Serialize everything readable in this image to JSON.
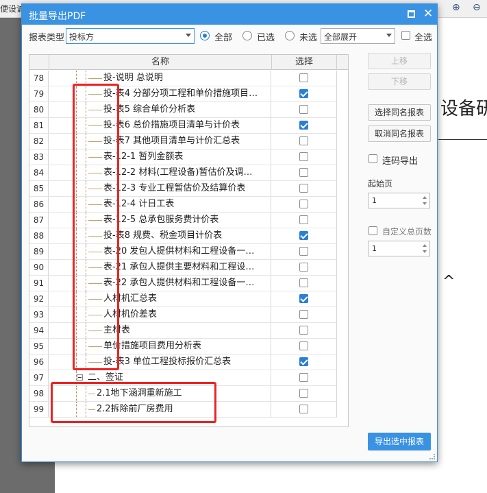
{
  "app": {
    "toolbar_left_fragment": "便设诚",
    "paper_heading_fragment": "设备研",
    "paper_mark_fragment": "^"
  },
  "dialog": {
    "title": "批量导出PDF",
    "filter": {
      "report_type_label": "报表类型",
      "report_type_value": "投标方",
      "radio_all": "全部",
      "radio_selected": "已选",
      "radio_unselected": "未选",
      "expand_value": "全部展开",
      "select_all": "全选"
    },
    "grid": {
      "header_name": "名称",
      "header_select": "选择",
      "rows": [
        {
          "num": "78",
          "name": "投-说明  总说明",
          "level": 2,
          "checked": false
        },
        {
          "num": "79",
          "name": "投-表4  分部分项工程和单价措施项目…",
          "level": 2,
          "checked": true
        },
        {
          "num": "80",
          "name": "投-表5  综合单价分析表",
          "level": 2,
          "checked": false
        },
        {
          "num": "81",
          "name": "投-表6  总价措施项目清单与计价表",
          "level": 2,
          "checked": true
        },
        {
          "num": "82",
          "name": "投-表7  其他项目清单与计价汇总表",
          "level": 2,
          "checked": false
        },
        {
          "num": "83",
          "name": "表-12-1  暂列金额表",
          "level": 2,
          "checked": false
        },
        {
          "num": "84",
          "name": "表-12-2  材料(工程设备)暂估价及调…",
          "level": 2,
          "checked": false
        },
        {
          "num": "85",
          "name": "表-12-3  专业工程暂估价及结算价表",
          "level": 2,
          "checked": false
        },
        {
          "num": "86",
          "name": "表-12-4  计日工表",
          "level": 2,
          "checked": false
        },
        {
          "num": "87",
          "name": "表-12-5  总承包服务费计价表",
          "level": 2,
          "checked": false
        },
        {
          "num": "88",
          "name": "投-表8  规费、税金项目计价表",
          "level": 2,
          "checked": true
        },
        {
          "num": "89",
          "name": "表-20  发包人提供材料和工程设备一…",
          "level": 2,
          "checked": false
        },
        {
          "num": "90",
          "name": "表-21  承包人提供主要材料和工程设…",
          "level": 2,
          "checked": false
        },
        {
          "num": "91",
          "name": "表-22  承包人提供材料和工程设备一…",
          "level": 2,
          "checked": false
        },
        {
          "num": "92",
          "name": "人材机汇总表",
          "level": 2,
          "checked": true
        },
        {
          "num": "93",
          "name": "人材机价差表",
          "level": 2,
          "checked": false
        },
        {
          "num": "94",
          "name": "主材表",
          "level": 2,
          "checked": false
        },
        {
          "num": "95",
          "name": "单价措施项目费用分析表",
          "level": 2,
          "checked": false
        },
        {
          "num": "96",
          "name": "投-表3  单位工程投标报价汇总表",
          "level": 2,
          "checked": true
        },
        {
          "num": "97",
          "name": "二、签证",
          "level": 1,
          "checked": false
        },
        {
          "num": "98",
          "name": "2.1地下涵洞重新施工",
          "level": 3,
          "checked": false
        },
        {
          "num": "99",
          "name": "2.2拆除前厂房费用",
          "level": 3,
          "checked": false
        }
      ]
    },
    "side": {
      "move_up": "上移",
      "move_down": "下移",
      "select_same_name": "选择同名报表",
      "cancel_same_name": "取消同名报表",
      "continuous_export": "连码导出",
      "start_page_label": "起始页",
      "start_page_value": "1",
      "custom_total_label": "自定义总页数",
      "custom_total_value": "1",
      "export_selected": "导出选中报表"
    }
  },
  "colors": {
    "accent": "#3a92e2",
    "annotation_red": "#ee2222"
  }
}
